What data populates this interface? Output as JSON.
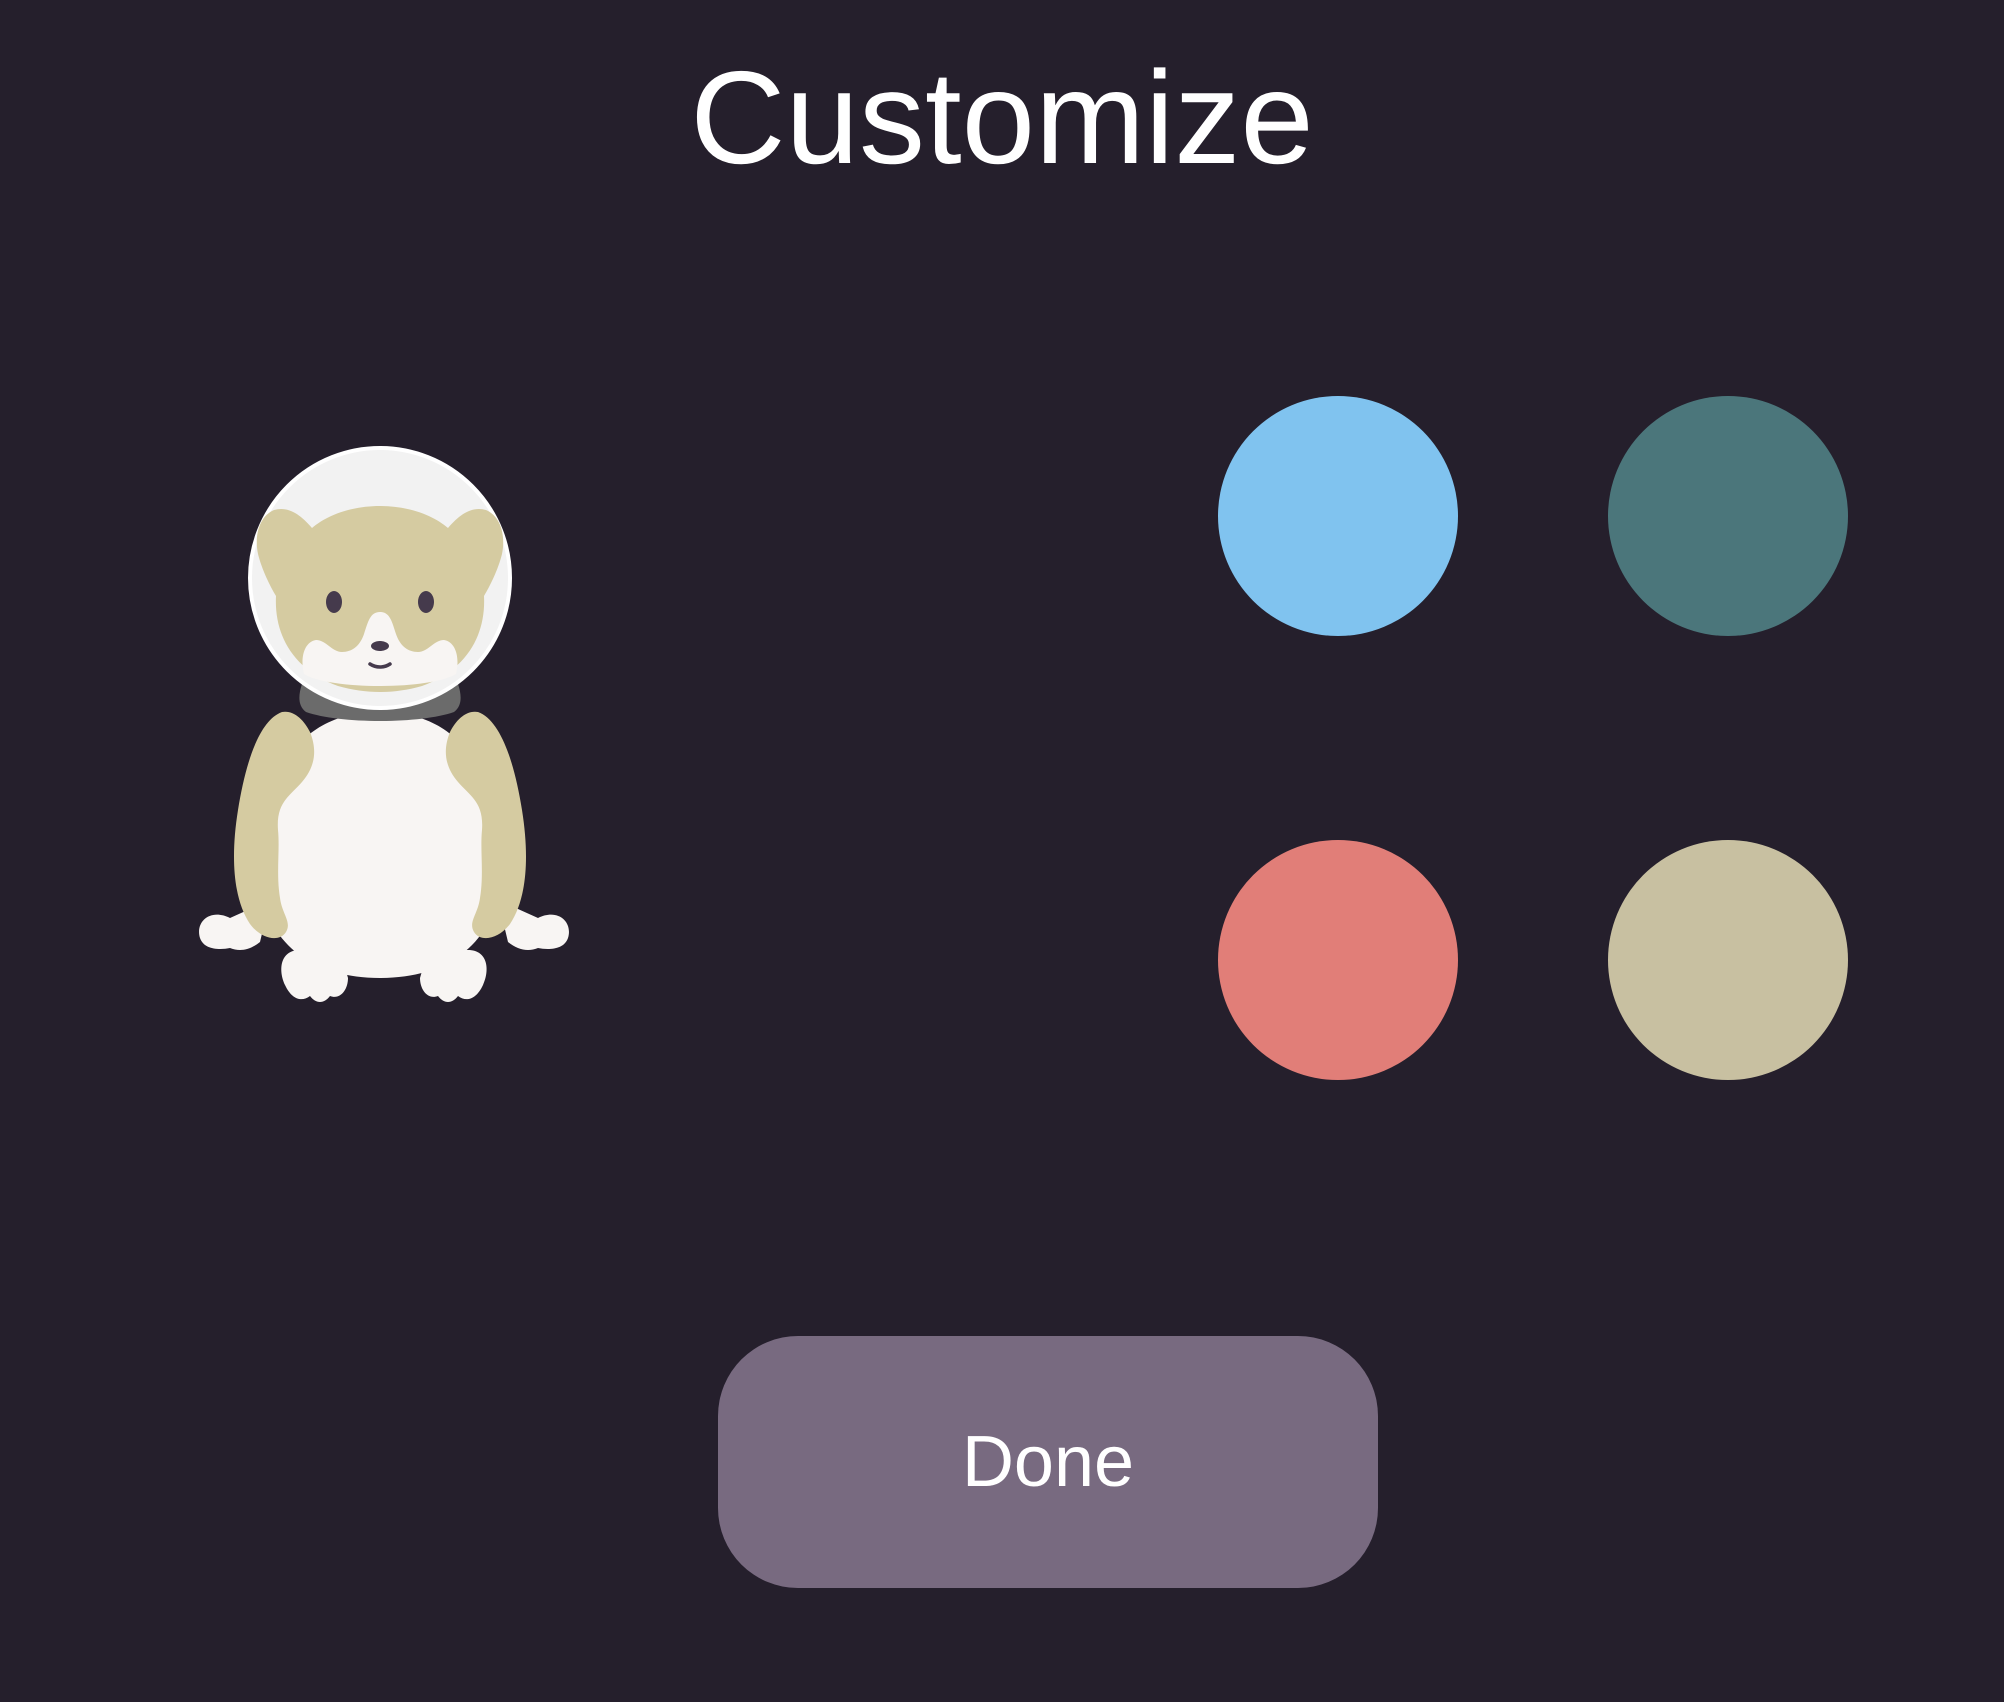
{
  "header": {
    "title": "Customize"
  },
  "avatar": {
    "icon": "ferret-astronaut-icon",
    "fur_color": "#d5cba1",
    "belly_color": "#f8f5f3",
    "helmet_color": "#f2f2f2",
    "collar_color": "#6b6b6b",
    "eye_color": "#453a4c"
  },
  "color_options": [
    {
      "name": "light-blue",
      "color": "#80c3ef"
    },
    {
      "name": "teal",
      "color": "#4b767b"
    },
    {
      "name": "salmon",
      "color": "#e17e78"
    },
    {
      "name": "beige",
      "color": "#c8c0a1"
    }
  ],
  "footer": {
    "done_label": "Done",
    "button_color": "#786a80"
  },
  "theme": {
    "background": "#251f2c",
    "text": "#ffffff"
  }
}
